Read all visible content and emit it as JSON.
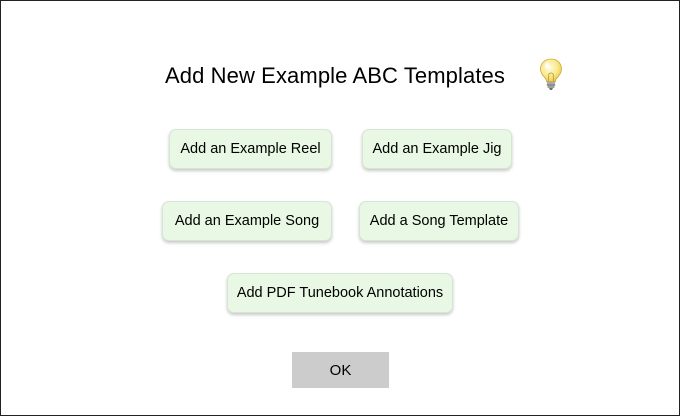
{
  "dialog": {
    "title": "Add New Example ABC Templates",
    "help_icon": "lightbulb-icon",
    "buttons": {
      "reel": "Add an Example Reel",
      "jig": "Add an Example Jig",
      "song": "Add an Example Song",
      "song_template": "Add a Song Template",
      "pdf_annotations": "Add PDF Tunebook Annotations"
    },
    "ok_label": "OK"
  },
  "colors": {
    "button_bg": "#e8f8e4",
    "ok_bg": "#cccccc",
    "bulb": "#f7e27a"
  }
}
